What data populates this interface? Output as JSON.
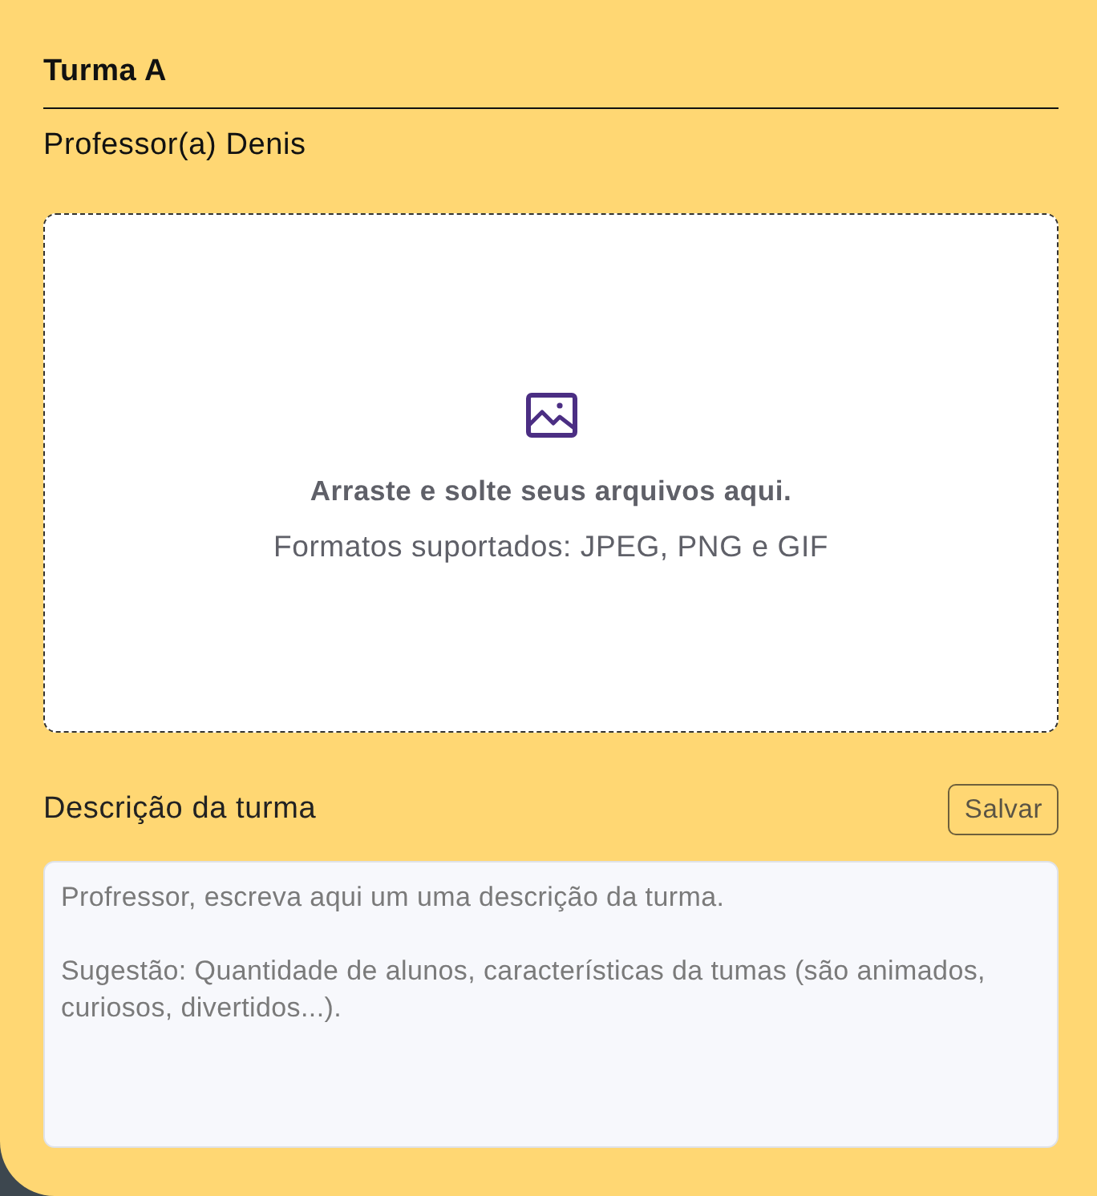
{
  "class_card": {
    "title": "Turma A",
    "teacher": "Professor(a) Denis"
  },
  "upload": {
    "instruction": "Arraste e solte seus arquivos aqui.",
    "formats": "Formatos suportados: JPEG, PNG e GIF"
  },
  "description": {
    "label": "Descrição da turma",
    "save_button": "Salvar",
    "placeholder": "Profressor, escreva aqui um uma descrição da turma.\n\nSugestão: Quantidade de alunos, características da tumas (são animados, curiosos, divertidos...)."
  }
}
